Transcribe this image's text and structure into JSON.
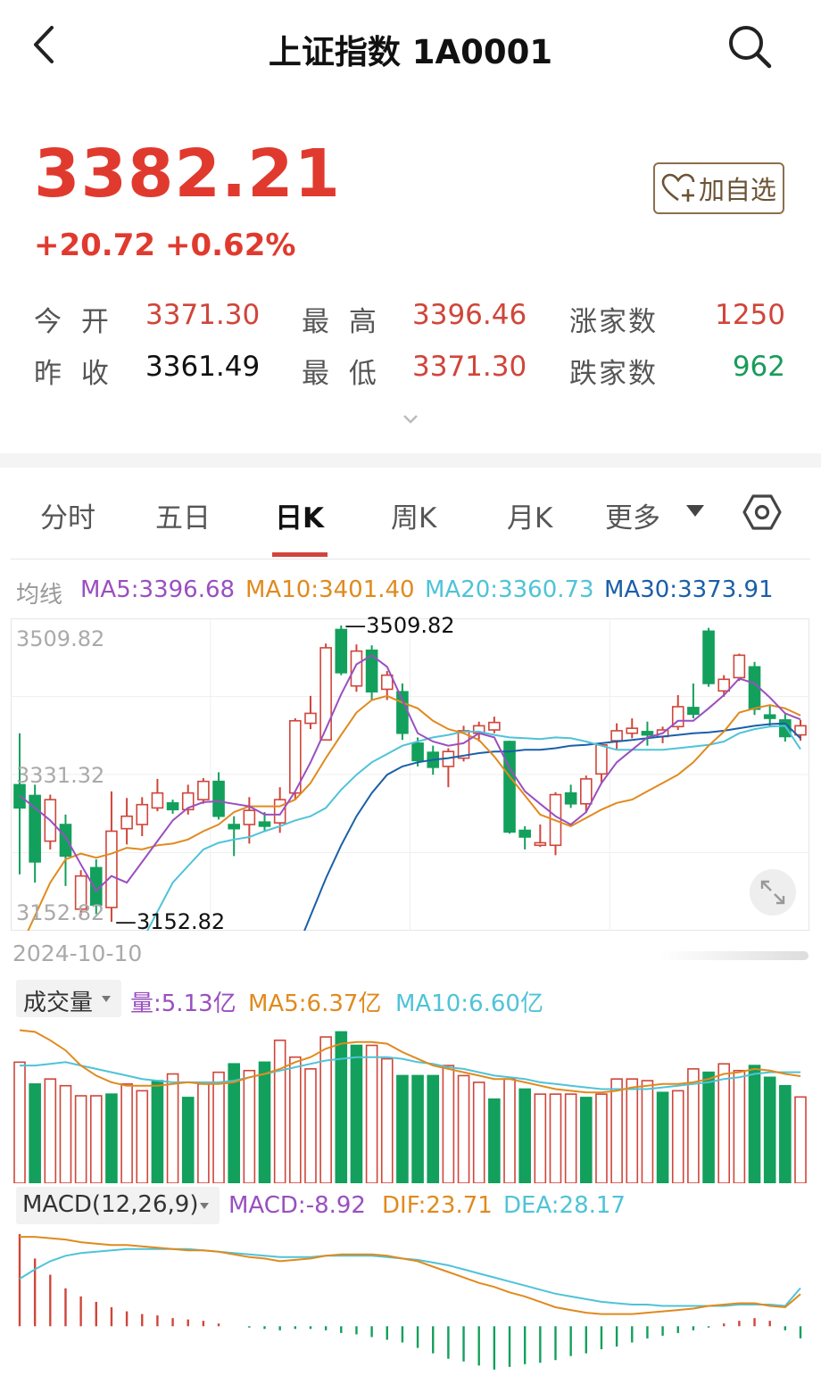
{
  "header": {
    "title": "上证指数 1A0001"
  },
  "quote": {
    "price": "3382.21",
    "change": "+20.72",
    "change_pct": "+0.62%",
    "watch_label": "加自选"
  },
  "stats": {
    "open_label": "今 开",
    "open": "3371.30",
    "high_label": "最 高",
    "high": "3396.46",
    "up_label": "涨家数",
    "up": "1250",
    "prev_label": "昨 收",
    "prev": "3361.49",
    "low_label": "最 低",
    "low": "3371.30",
    "down_label": "跌家数",
    "down": "962"
  },
  "tabs": [
    "分时",
    "五日",
    "日K",
    "周K",
    "月K",
    "更多"
  ],
  "active_tab": "日K",
  "ma_legend": {
    "label": "均线",
    "ma5": "MA5:3396.68",
    "ma10": "MA10:3401.40",
    "ma20": "MA20:3360.73",
    "ma30": "MA30:3373.91"
  },
  "y_ticks": [
    "3509.82",
    "3331.32",
    "3152.82"
  ],
  "high_marker": "3509.82",
  "low_marker": "3152.82",
  "start_date": "2024-10-10",
  "volume": {
    "selector": "成交量",
    "vol": "量:5.13亿",
    "ma5": "MA5:6.37亿",
    "ma10": "MA10:6.60亿"
  },
  "macd": {
    "selector": "MACD(12,26,9)",
    "macd": "MACD:-8.92",
    "dif": "DIF:23.71",
    "dea": "DEA:28.17"
  },
  "colors": {
    "up": "#d0453a",
    "down": "#12a05c",
    "ma5": "#9a4fc0",
    "ma10": "#e08a1e",
    "ma20": "#4fc3d8",
    "ma30": "#1a5fa8"
  },
  "chart_data": {
    "type": "candlestick",
    "y_range": [
      3152.82,
      3509.82
    ],
    "candles": [
      {
        "o": 3318,
        "c": 3290,
        "h": 3380,
        "l": 3210
      },
      {
        "o": 3305,
        "c": 3225,
        "h": 3318,
        "l": 3200
      },
      {
        "o": 3250,
        "c": 3300,
        "h": 3306,
        "l": 3240
      },
      {
        "o": 3270,
        "c": 3232,
        "h": 3282,
        "l": 3196
      },
      {
        "o": 3168,
        "c": 3208,
        "h": 3215,
        "l": 3160
      },
      {
        "o": 3218,
        "c": 3173,
        "h": 3228,
        "l": 3162
      },
      {
        "o": 3170,
        "c": 3262,
        "h": 3310,
        "l": 3152.82
      },
      {
        "o": 3265,
        "c": 3280,
        "h": 3302,
        "l": 3246
      },
      {
        "o": 3270,
        "c": 3294,
        "h": 3303,
        "l": 3256
      },
      {
        "o": 3290,
        "c": 3308,
        "h": 3325,
        "l": 3286
      },
      {
        "o": 3296,
        "c": 3288,
        "h": 3300,
        "l": 3283
      },
      {
        "o": 3288,
        "c": 3308,
        "h": 3318,
        "l": 3282
      },
      {
        "o": 3300,
        "c": 3322,
        "h": 3326,
        "l": 3295
      },
      {
        "o": 3322,
        "c": 3280,
        "h": 3333,
        "l": 3276
      },
      {
        "o": 3270,
        "c": 3265,
        "h": 3280,
        "l": 3232
      },
      {
        "o": 3270,
        "c": 3287,
        "h": 3303,
        "l": 3247
      },
      {
        "o": 3273,
        "c": 3268,
        "h": 3285,
        "l": 3261
      },
      {
        "o": 3272,
        "c": 3300,
        "h": 3315,
        "l": 3260
      },
      {
        "o": 3308,
        "c": 3395,
        "h": 3398,
        "l": 3300
      },
      {
        "o": 3392,
        "c": 3404,
        "h": 3425,
        "l": 3385
      },
      {
        "o": 3372,
        "c": 3483,
        "h": 3488,
        "l": 3372
      },
      {
        "o": 3505,
        "c": 3453,
        "h": 3509.82,
        "l": 3450
      },
      {
        "o": 3437,
        "c": 3479,
        "h": 3487,
        "l": 3430
      },
      {
        "o": 3480,
        "c": 3430,
        "h": 3486,
        "l": 3420
      },
      {
        "o": 3433,
        "c": 3450,
        "h": 3455,
        "l": 3420
      },
      {
        "o": 3430,
        "c": 3380,
        "h": 3440,
        "l": 3372
      },
      {
        "o": 3368,
        "c": 3347,
        "h": 3375,
        "l": 3340
      },
      {
        "o": 3357,
        "c": 3339,
        "h": 3365,
        "l": 3330
      },
      {
        "o": 3340,
        "c": 3358,
        "h": 3362,
        "l": 3315
      },
      {
        "o": 3350,
        "c": 3383,
        "h": 3389,
        "l": 3346
      },
      {
        "o": 3380,
        "c": 3389,
        "h": 3394,
        "l": 3370
      },
      {
        "o": 3384,
        "c": 3393,
        "h": 3400,
        "l": 3380
      },
      {
        "o": 3370,
        "c": 3261,
        "h": 3371,
        "l": 3259
      },
      {
        "o": 3263,
        "c": 3255,
        "h": 3268,
        "l": 3240
      },
      {
        "o": 3245,
        "c": 3248,
        "h": 3270,
        "l": 3243
      },
      {
        "o": 3245,
        "c": 3306,
        "h": 3309,
        "l": 3233
      },
      {
        "o": 3308,
        "c": 3295,
        "h": 3318,
        "l": 3290
      },
      {
        "o": 3295,
        "c": 3325,
        "h": 3329,
        "l": 3284
      },
      {
        "o": 3331,
        "c": 3366,
        "h": 3369,
        "l": 3319
      },
      {
        "o": 3371,
        "c": 3383,
        "h": 3392,
        "l": 3361
      },
      {
        "o": 3380,
        "c": 3386,
        "h": 3398,
        "l": 3374
      },
      {
        "o": 3382,
        "c": 3378,
        "h": 3394,
        "l": 3365
      },
      {
        "o": 3376,
        "c": 3384,
        "h": 3388,
        "l": 3368
      },
      {
        "o": 3388,
        "c": 3412,
        "h": 3426,
        "l": 3384
      },
      {
        "o": 3411,
        "c": 3403,
        "h": 3440,
        "l": 3398
      },
      {
        "o": 3503,
        "c": 3440,
        "h": 3507,
        "l": 3436
      },
      {
        "o": 3431,
        "c": 3445,
        "h": 3450,
        "l": 3424
      },
      {
        "o": 3447,
        "c": 3474,
        "h": 3476,
        "l": 3443
      },
      {
        "o": 3460,
        "c": 3409,
        "h": 3466,
        "l": 3402
      },
      {
        "o": 3402,
        "c": 3398,
        "h": 3413,
        "l": 3388
      },
      {
        "o": 3396,
        "c": 3376,
        "h": 3403,
        "l": 3370
      },
      {
        "o": 3378,
        "c": 3389,
        "h": 3396,
        "l": 3371
      }
    ],
    "ma5": [
      3305,
      3290,
      3275,
      3255,
      3222,
      3190,
      3208,
      3200,
      3225,
      3250,
      3275,
      3290,
      3297,
      3298,
      3295,
      3292,
      3282,
      3282,
      3310,
      3345,
      3385,
      3427,
      3463,
      3474,
      3460,
      3420,
      3380,
      3370,
      3365,
      3368,
      3380,
      3375,
      3338,
      3310,
      3295,
      3280,
      3270,
      3285,
      3320,
      3345,
      3360,
      3375,
      3380,
      3395,
      3395,
      3410,
      3426,
      3446,
      3440,
      3423,
      3404,
      3396.68
    ],
    "ma10": [
      3120,
      3160,
      3200,
      3228,
      3235,
      3230,
      3235,
      3242,
      3240,
      3245,
      3247,
      3252,
      3262,
      3270,
      3285,
      3292,
      3292,
      3292,
      3300,
      3320,
      3350,
      3378,
      3405,
      3420,
      3425,
      3417,
      3410,
      3395,
      3385,
      3380,
      3372,
      3352,
      3328,
      3305,
      3282,
      3275,
      3268,
      3278,
      3288,
      3296,
      3300,
      3310,
      3320,
      3330,
      3345,
      3365,
      3382,
      3405,
      3410,
      3414,
      3410,
      3401.4
    ],
    "ma20": [
      null,
      null,
      null,
      null,
      null,
      null,
      null,
      3100,
      3130,
      3165,
      3200,
      3220,
      3240,
      3248,
      3252,
      3255,
      3262,
      3268,
      3275,
      3280,
      3290,
      3312,
      3330,
      3345,
      3355,
      3365,
      3370,
      3375,
      3378,
      3382,
      3382,
      3378,
      3375,
      3374,
      3373,
      3375,
      3374,
      3370,
      3365,
      3360,
      3360,
      3360,
      3360,
      3362,
      3364,
      3366,
      3370,
      3380,
      3385,
      3388,
      3389,
      3360.73
    ],
    "ma30": [
      null,
      null,
      null,
      null,
      null,
      null,
      null,
      null,
      null,
      null,
      null,
      null,
      null,
      null,
      null,
      null,
      null,
      null,
      3115,
      3160,
      3205,
      3245,
      3280,
      3308,
      3330,
      3340,
      3345,
      3348,
      3350,
      3353,
      3356,
      3358,
      3358,
      3360,
      3360,
      3362,
      3365,
      3366,
      3368,
      3370,
      3372,
      3374,
      3376,
      3378,
      3380,
      3381,
      3383,
      3386,
      3389,
      3391,
      3392,
      3373.91
    ],
    "volume": {
      "bars": [
        7.2,
        5.9,
        6.2,
        5.8,
        5.2,
        5.2,
        5.3,
        5.9,
        5.5,
        6.1,
        6.5,
        5.1,
        5.9,
        6.6,
        7.1,
        6.7,
        7.2,
        8.5,
        7.5,
        6.8,
        8.7,
        9.0,
        8.2,
        8.2,
        7.4,
        6.4,
        6.4,
        6.4,
        7.0,
        6.4,
        6.0,
        5.0,
        6.2,
        5.6,
        5.3,
        5.3,
        5.3,
        5.1,
        5.3,
        6.2,
        6.2,
        6.1,
        5.4,
        5.5,
        6.8,
        6.6,
        7.1,
        6.7,
        7.0,
        6.3,
        5.8,
        5.13
      ],
      "up": [
        true,
        false,
        true,
        true,
        true,
        true,
        false,
        true,
        true,
        false,
        true,
        false,
        true,
        true,
        false,
        true,
        false,
        true,
        true,
        true,
        true,
        false,
        false,
        true,
        true,
        false,
        false,
        false,
        true,
        true,
        true,
        false,
        true,
        false,
        true,
        true,
        true,
        false,
        true,
        true,
        true,
        true,
        false,
        true,
        true,
        false,
        true,
        true,
        false,
        false,
        false,
        true
      ],
      "range": [
        0,
        9.5
      ],
      "ma5": [
        9.1,
        9.0,
        8.5,
        7.9,
        7.0,
        6.4,
        6.0,
        5.8,
        5.8,
        5.8,
        5.9,
        6.0,
        5.9,
        5.9,
        6.0,
        6.3,
        6.5,
        6.8,
        7.2,
        7.5,
        8.0,
        8.3,
        8.4,
        8.4,
        8.3,
        7.8,
        7.4,
        7.0,
        6.8,
        6.6,
        6.4,
        6.2,
        6.2,
        6.0,
        5.8,
        5.6,
        5.5,
        5.4,
        5.4,
        5.5,
        5.7,
        5.8,
        5.9,
        5.9,
        6.0,
        6.2,
        6.5,
        6.6,
        6.8,
        6.7,
        6.5,
        6.37
      ],
      "ma10": [
        7.0,
        7.0,
        7.1,
        7.2,
        7.0,
        6.8,
        6.6,
        6.4,
        6.2,
        6.1,
        6.0,
        6.0,
        6.0,
        6.0,
        6.1,
        6.3,
        6.5,
        6.7,
        6.9,
        7.1,
        7.3,
        7.4,
        7.5,
        7.5,
        7.5,
        7.4,
        7.2,
        7.1,
        6.9,
        6.8,
        6.6,
        6.4,
        6.3,
        6.2,
        6.0,
        5.9,
        5.8,
        5.7,
        5.6,
        5.6,
        5.6,
        5.6,
        5.7,
        5.8,
        5.9,
        6.0,
        6.2,
        6.3,
        6.5,
        6.6,
        6.6,
        6.6
      ]
    },
    "macd_series": {
      "range": [
        -40,
        70
      ],
      "hist": [
        68,
        50,
        38,
        28,
        22,
        18,
        14,
        11,
        9,
        8,
        6,
        5,
        4,
        2,
        0,
        -1,
        -2,
        -3,
        -2,
        -2,
        -3,
        -5,
        -6,
        -8,
        -10,
        -12,
        -16,
        -20,
        -24,
        -26,
        -29,
        -32,
        -30,
        -28,
        -27,
        -25,
        -22,
        -20,
        -17,
        -15,
        -12,
        -9,
        -7,
        -5,
        -3,
        -1,
        2,
        4,
        6,
        4,
        -3,
        -8.92
      ],
      "dif": [
        66,
        66,
        65,
        64,
        62,
        61,
        60,
        60,
        59,
        58,
        57,
        56,
        56,
        55,
        53,
        51,
        50,
        48,
        49,
        50,
        52,
        53,
        53,
        53,
        52,
        50,
        48,
        44,
        40,
        36,
        32,
        29,
        25,
        22,
        18,
        14,
        12,
        10,
        9,
        9,
        9,
        10,
        11,
        12,
        13,
        15,
        16,
        17,
        17,
        15,
        14,
        23.71
      ],
      "dea": [
        35,
        42,
        48,
        52,
        54,
        55,
        56,
        57,
        57,
        57,
        57,
        57,
        56,
        55,
        54,
        53,
        52,
        51,
        51,
        51,
        52,
        52,
        52,
        52,
        51,
        50,
        49,
        47,
        45,
        42,
        39,
        36,
        33,
        30,
        27,
        24,
        22,
        20,
        18,
        17,
        16,
        16,
        15,
        15,
        15,
        15,
        15,
        16,
        16,
        16,
        15,
        28.17
      ]
    }
  }
}
